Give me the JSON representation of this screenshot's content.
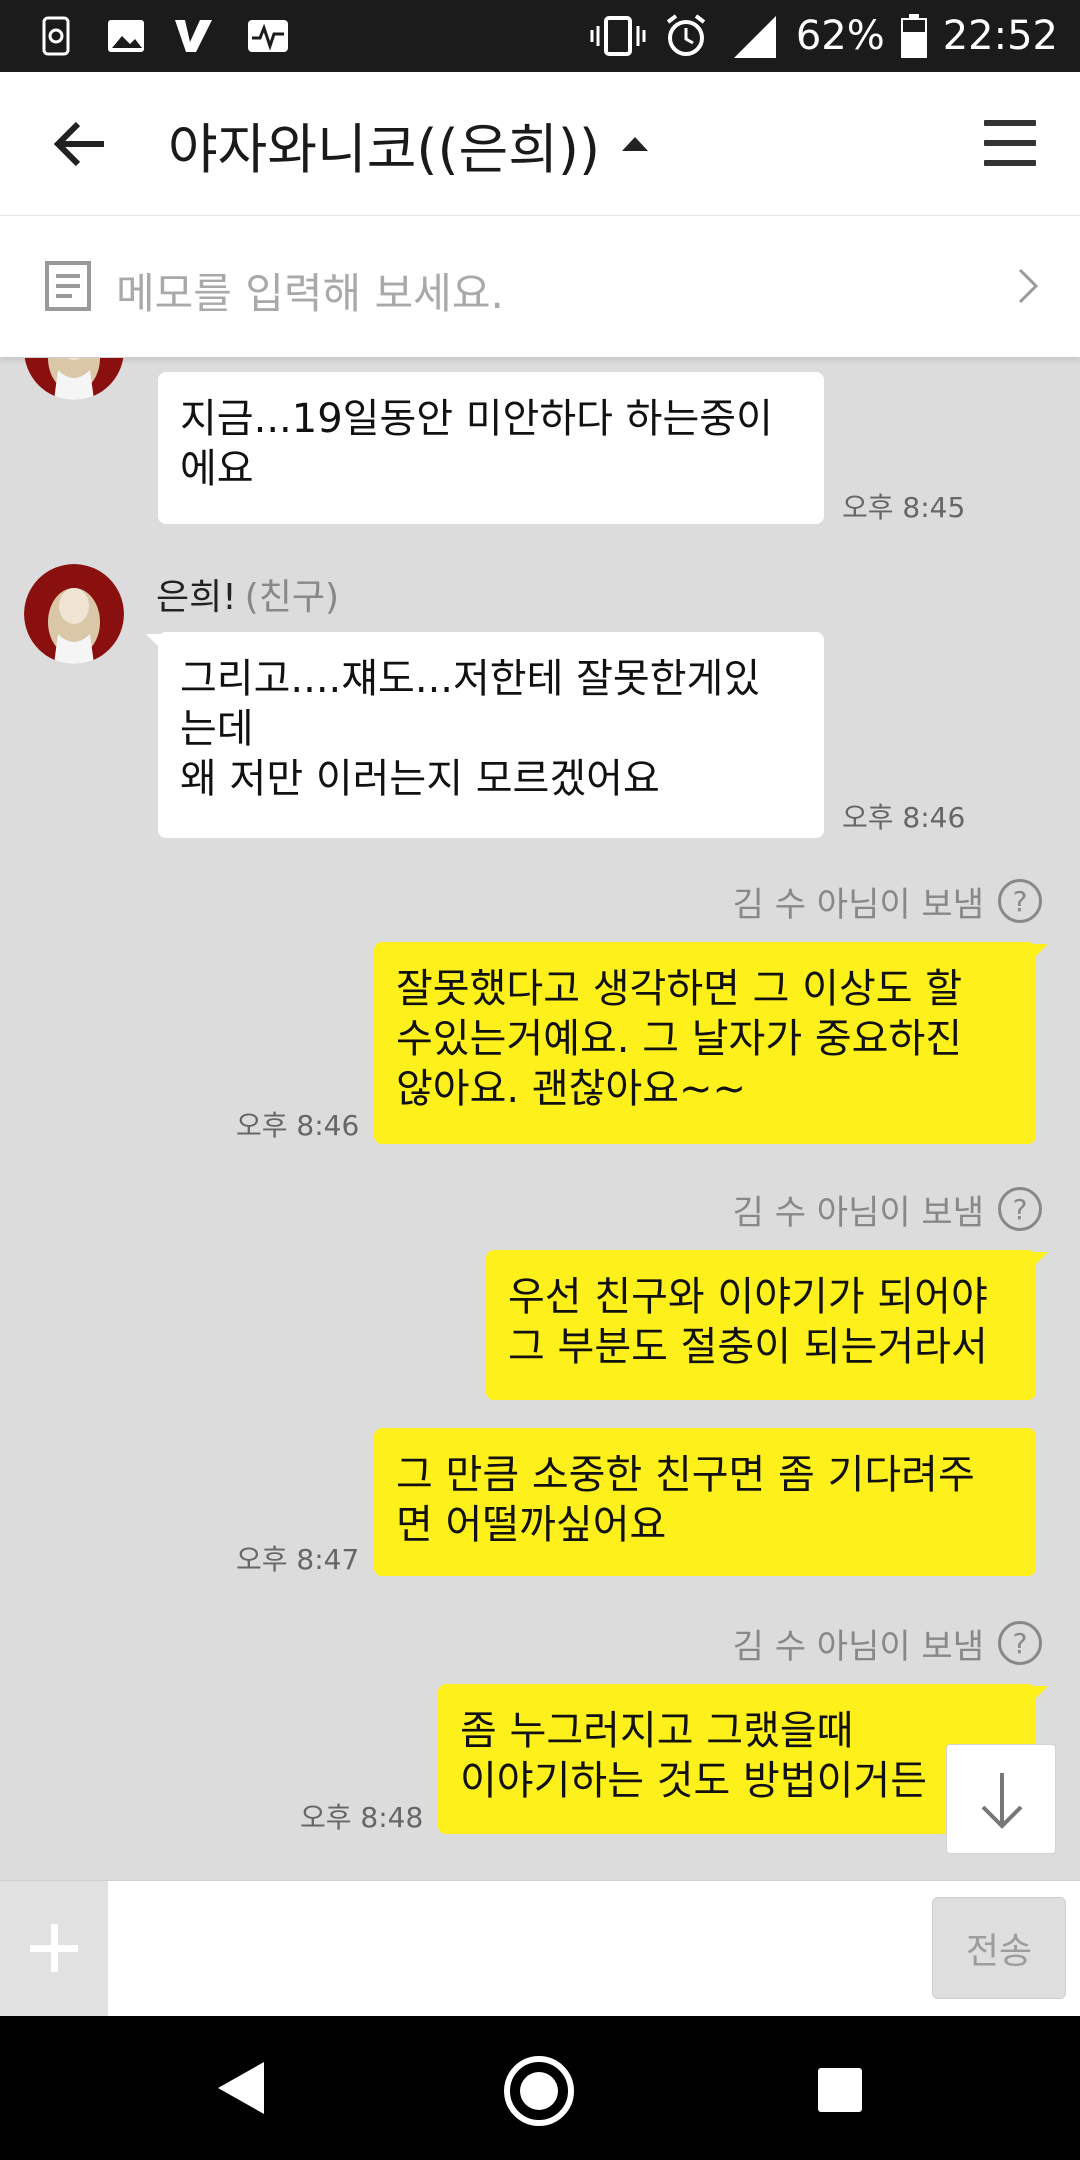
{
  "status_bar": {
    "battery": "62%",
    "time": "22:52",
    "network": "LTE+"
  },
  "header": {
    "title": "야자와니코((은희))"
  },
  "memo": {
    "placeholder": "메모를 입력해 보세요."
  },
  "messages": {
    "m1": {
      "text": "지금...19일동안 미안하다 하는중이\n에요",
      "time": "오후 8:45"
    },
    "sender": {
      "name": "은희!",
      "tag": "(친구)"
    },
    "m2": {
      "text": "그리고....쟤도...저한테 잘못한게있\n는데\n왜 저만 이러는지 모르겠어요",
      "time": "오후 8:46"
    },
    "via1": "김 수 아님이 보냄",
    "m3": {
      "text": "잘못했다고 생각하면 그 이상도 할\n수있는거예요. 그 날자가 중요하진\n않아요. 괜찮아요~~",
      "time": "오후 8:46"
    },
    "via2": "김 수 아님이 보냄",
    "m4": {
      "text": "우선 친구와 이야기가 되어야\n그 부분도 절충이 되는거라서"
    },
    "m5": {
      "text": "그 만큼 소중한 친구면 좀 기다려주\n면 어떨까싶어요",
      "time": "오후 8:47"
    },
    "via3": "김 수 아님이 보냄",
    "m6": {
      "text": "좀 누그러지고 그랬을때\n이야기하는 것도 방법이거든",
      "time": "오후 8:48"
    },
    "help_glyph": "?"
  },
  "input": {
    "value": "",
    "send_label": "전송"
  },
  "colors": {
    "outgoing_bubble": "#fef01b",
    "incoming_bubble": "#ffffff",
    "chat_background": "#dcdcdc"
  }
}
